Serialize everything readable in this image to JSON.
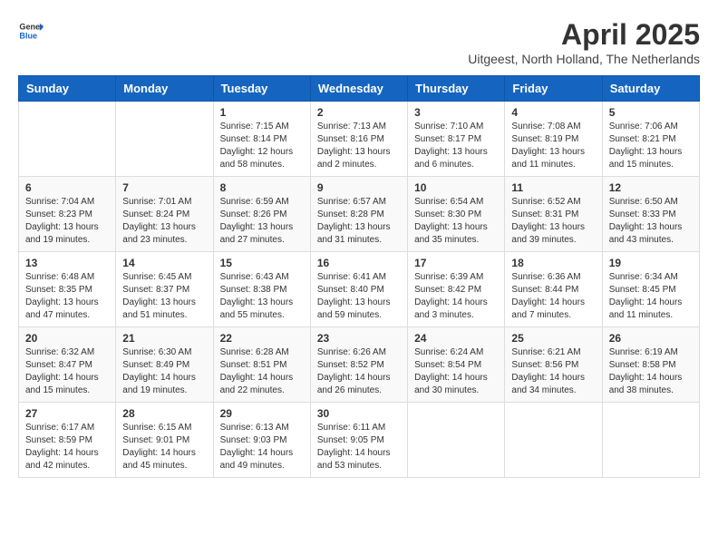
{
  "header": {
    "logo_general": "General",
    "logo_blue": "Blue",
    "title": "April 2025",
    "subtitle": "Uitgeest, North Holland, The Netherlands"
  },
  "weekdays": [
    "Sunday",
    "Monday",
    "Tuesday",
    "Wednesday",
    "Thursday",
    "Friday",
    "Saturday"
  ],
  "weeks": [
    [
      {
        "day": "",
        "info": ""
      },
      {
        "day": "",
        "info": ""
      },
      {
        "day": "1",
        "info": "Sunrise: 7:15 AM\nSunset: 8:14 PM\nDaylight: 12 hours and 58 minutes."
      },
      {
        "day": "2",
        "info": "Sunrise: 7:13 AM\nSunset: 8:16 PM\nDaylight: 13 hours and 2 minutes."
      },
      {
        "day": "3",
        "info": "Sunrise: 7:10 AM\nSunset: 8:17 PM\nDaylight: 13 hours and 6 minutes."
      },
      {
        "day": "4",
        "info": "Sunrise: 7:08 AM\nSunset: 8:19 PM\nDaylight: 13 hours and 11 minutes."
      },
      {
        "day": "5",
        "info": "Sunrise: 7:06 AM\nSunset: 8:21 PM\nDaylight: 13 hours and 15 minutes."
      }
    ],
    [
      {
        "day": "6",
        "info": "Sunrise: 7:04 AM\nSunset: 8:23 PM\nDaylight: 13 hours and 19 minutes."
      },
      {
        "day": "7",
        "info": "Sunrise: 7:01 AM\nSunset: 8:24 PM\nDaylight: 13 hours and 23 minutes."
      },
      {
        "day": "8",
        "info": "Sunrise: 6:59 AM\nSunset: 8:26 PM\nDaylight: 13 hours and 27 minutes."
      },
      {
        "day": "9",
        "info": "Sunrise: 6:57 AM\nSunset: 8:28 PM\nDaylight: 13 hours and 31 minutes."
      },
      {
        "day": "10",
        "info": "Sunrise: 6:54 AM\nSunset: 8:30 PM\nDaylight: 13 hours and 35 minutes."
      },
      {
        "day": "11",
        "info": "Sunrise: 6:52 AM\nSunset: 8:31 PM\nDaylight: 13 hours and 39 minutes."
      },
      {
        "day": "12",
        "info": "Sunrise: 6:50 AM\nSunset: 8:33 PM\nDaylight: 13 hours and 43 minutes."
      }
    ],
    [
      {
        "day": "13",
        "info": "Sunrise: 6:48 AM\nSunset: 8:35 PM\nDaylight: 13 hours and 47 minutes."
      },
      {
        "day": "14",
        "info": "Sunrise: 6:45 AM\nSunset: 8:37 PM\nDaylight: 13 hours and 51 minutes."
      },
      {
        "day": "15",
        "info": "Sunrise: 6:43 AM\nSunset: 8:38 PM\nDaylight: 13 hours and 55 minutes."
      },
      {
        "day": "16",
        "info": "Sunrise: 6:41 AM\nSunset: 8:40 PM\nDaylight: 13 hours and 59 minutes."
      },
      {
        "day": "17",
        "info": "Sunrise: 6:39 AM\nSunset: 8:42 PM\nDaylight: 14 hours and 3 minutes."
      },
      {
        "day": "18",
        "info": "Sunrise: 6:36 AM\nSunset: 8:44 PM\nDaylight: 14 hours and 7 minutes."
      },
      {
        "day": "19",
        "info": "Sunrise: 6:34 AM\nSunset: 8:45 PM\nDaylight: 14 hours and 11 minutes."
      }
    ],
    [
      {
        "day": "20",
        "info": "Sunrise: 6:32 AM\nSunset: 8:47 PM\nDaylight: 14 hours and 15 minutes."
      },
      {
        "day": "21",
        "info": "Sunrise: 6:30 AM\nSunset: 8:49 PM\nDaylight: 14 hours and 19 minutes."
      },
      {
        "day": "22",
        "info": "Sunrise: 6:28 AM\nSunset: 8:51 PM\nDaylight: 14 hours and 22 minutes."
      },
      {
        "day": "23",
        "info": "Sunrise: 6:26 AM\nSunset: 8:52 PM\nDaylight: 14 hours and 26 minutes."
      },
      {
        "day": "24",
        "info": "Sunrise: 6:24 AM\nSunset: 8:54 PM\nDaylight: 14 hours and 30 minutes."
      },
      {
        "day": "25",
        "info": "Sunrise: 6:21 AM\nSunset: 8:56 PM\nDaylight: 14 hours and 34 minutes."
      },
      {
        "day": "26",
        "info": "Sunrise: 6:19 AM\nSunset: 8:58 PM\nDaylight: 14 hours and 38 minutes."
      }
    ],
    [
      {
        "day": "27",
        "info": "Sunrise: 6:17 AM\nSunset: 8:59 PM\nDaylight: 14 hours and 42 minutes."
      },
      {
        "day": "28",
        "info": "Sunrise: 6:15 AM\nSunset: 9:01 PM\nDaylight: 14 hours and 45 minutes."
      },
      {
        "day": "29",
        "info": "Sunrise: 6:13 AM\nSunset: 9:03 PM\nDaylight: 14 hours and 49 minutes."
      },
      {
        "day": "30",
        "info": "Sunrise: 6:11 AM\nSunset: 9:05 PM\nDaylight: 14 hours and 53 minutes."
      },
      {
        "day": "",
        "info": ""
      },
      {
        "day": "",
        "info": ""
      },
      {
        "day": "",
        "info": ""
      }
    ]
  ]
}
